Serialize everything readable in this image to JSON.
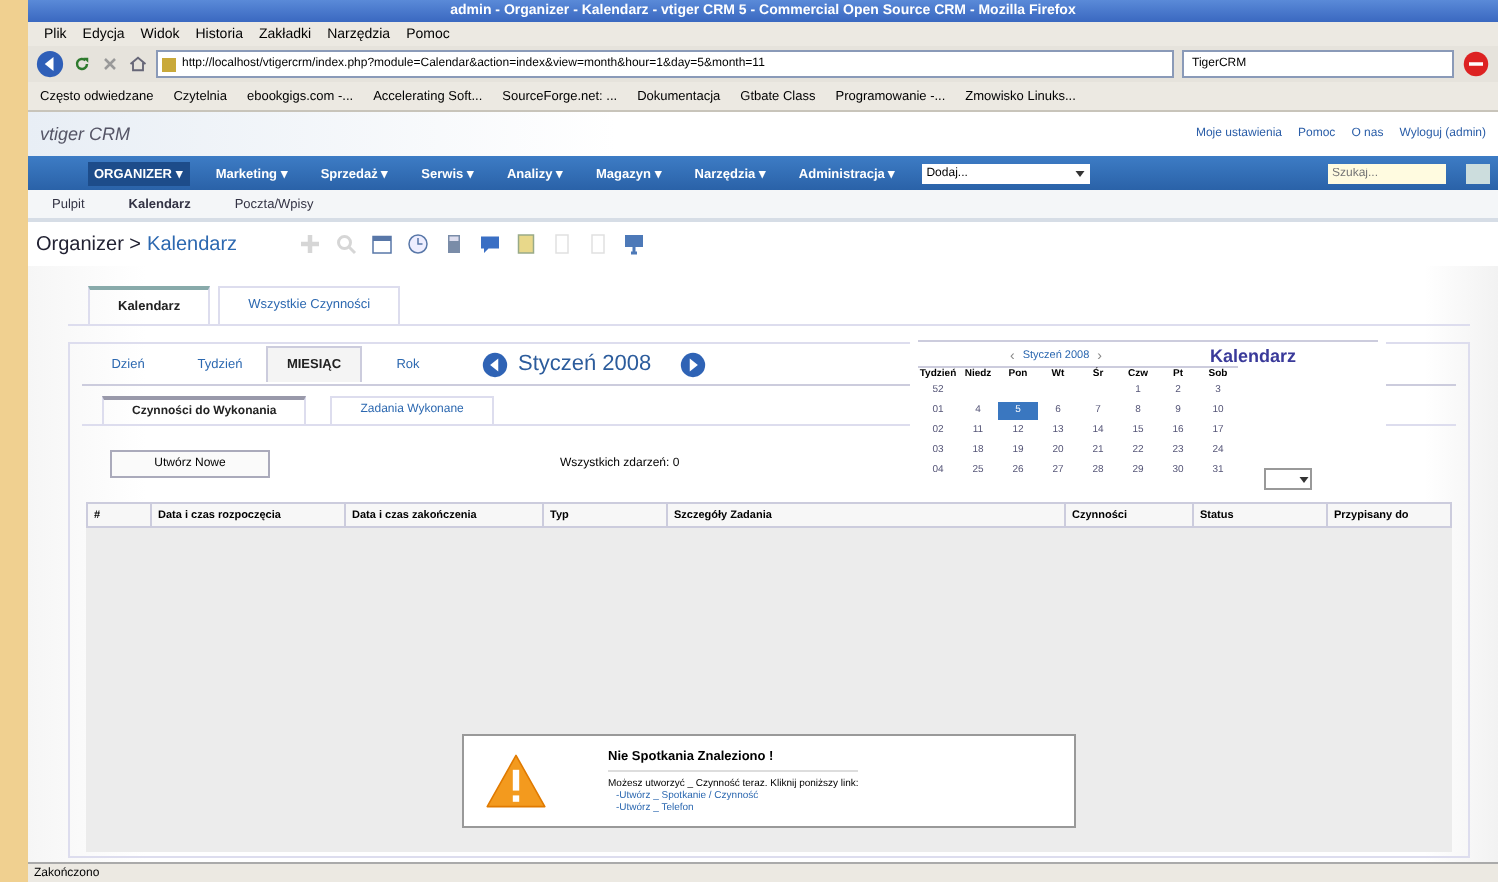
{
  "window": {
    "title": "admin - Organizer - Kalendarz - vtiger CRM 5 - Commercial Open Source CRM - Mozilla Firefox"
  },
  "menu_bar": [
    "Plik",
    "Edycja",
    "Widok",
    "Historia",
    "Zakładki",
    "Narzędzia",
    "Pomoc"
  ],
  "address_bar": {
    "url": "http://localhost/vtigercrm/index.php?module=Calendar&action=index&view=month&hour=1&day=5&month=11"
  },
  "search_engine": {
    "value": "TigerCRM"
  },
  "bookmarks": [
    "Często odwiedzane",
    "Czytelnia",
    "ebookgigs.com -...",
    "Accelerating Soft...",
    "SourceForge.net: ...",
    "Dokumentacja",
    "Gtbate Class",
    "Programowanie -...",
    "Zmowisko Linuks..."
  ],
  "app": {
    "logo": "vtiger CRM",
    "header_links": [
      "Moje ustawienia",
      "Pomoc",
      "O nas",
      "Wyloguj (admin)"
    ]
  },
  "main_menu": [
    {
      "label": "ORGANIZER ▾",
      "selected": true
    },
    {
      "label": "Marketing ▾",
      "selected": false
    },
    {
      "label": "Sprzedaż ▾",
      "selected": false
    },
    {
      "label": "Serwis ▾",
      "selected": false
    },
    {
      "label": "Analizy ▾",
      "selected": false
    },
    {
      "label": "Magazyn ▾",
      "selected": false
    },
    {
      "label": "Narzędzia ▾",
      "selected": false
    },
    {
      "label": "Administracja ▾",
      "selected": false
    }
  ],
  "quick_create": {
    "value": "Dodaj..."
  },
  "search": {
    "placeholder": "Szukaj..."
  },
  "sub_tabs": [
    {
      "label": "Pulpit",
      "selected": false
    },
    {
      "label": "Kalendarz",
      "selected": true
    },
    {
      "label": "Poczta/Wpisy",
      "selected": false
    }
  ],
  "breadcrumb": {
    "module": "Organizer >",
    "page": "Kalendarz"
  },
  "outer_tabs": [
    {
      "label": "Kalendarz",
      "selected": true
    },
    {
      "label": "Wszystkie Czynności",
      "selected": false
    }
  ],
  "view_tabs": [
    {
      "label": "Dzień",
      "selected": false
    },
    {
      "label": "Tydzień",
      "selected": false
    },
    {
      "label": "MIESIĄC",
      "selected": true
    },
    {
      "label": "Rok",
      "selected": false
    }
  ],
  "period": "Styczeń 2008",
  "inner_tabs": [
    {
      "label": "Czynności do Wykonania",
      "selected": true
    },
    {
      "label": "Zadania Wykonane",
      "selected": false
    }
  ],
  "create_button": "Utwórz Nowe",
  "total": "Wszystkich zdarzeń: 0",
  "table": {
    "columns": [
      "#",
      "Data i czas rozpoczęcia",
      "Data i czas zakończenia",
      "Typ",
      "Szczegóły Zadania",
      "Czynności",
      "Status",
      "Przypisany do"
    ]
  },
  "message": {
    "title": "Nie Spotkania Znaleziono !",
    "text": "Możesz utworzyć _ Czynność teraz. Kliknij poniższy link:",
    "links": [
      "-Utwórz _ Spotkanie / Czynność",
      "-Utwórz _ Telefon"
    ]
  },
  "mini_calendar": {
    "title": "Styczeń 2008",
    "heading": "Kalendarz",
    "columns": [
      "Tydzień",
      "Niedz",
      "Pon",
      "Wt",
      "Śr",
      "Czw",
      "Pt",
      "Sob"
    ],
    "prev": "‹",
    "next": "›",
    "weeks": [
      {
        "week": "52",
        "days": [
          {
            "day": "1",
            "selected": false
          },
          {
            "day": "2",
            "selected": false
          },
          {
            "day": "3",
            "selected": false
          }
        ]
      },
      {
        "week": "01",
        "days": [
          {
            "day": "4",
            "selected": false
          },
          {
            "day": "5",
            "selected": true
          },
          {
            "day": "6",
            "selected": false
          },
          {
            "day": "7",
            "selected": false
          },
          {
            "day": "8",
            "selected": false
          },
          {
            "day": "9",
            "selected": false
          },
          {
            "day": "10",
            "selected": false
          }
        ]
      },
      {
        "week": "02",
        "days": [
          {
            "day": "11",
            "selected": false
          },
          {
            "day": "12",
            "selected": false
          },
          {
            "day": "13",
            "selected": false
          },
          {
            "day": "14",
            "selected": false
          },
          {
            "day": "15",
            "selected": false
          },
          {
            "day": "16",
            "selected": false
          },
          {
            "day": "17",
            "selected": false
          }
        ]
      },
      {
        "week": "03",
        "days": [
          {
            "day": "18",
            "selected": false
          },
          {
            "day": "19",
            "selected": false
          },
          {
            "day": "20",
            "selected": false
          },
          {
            "day": "21",
            "selected": false
          },
          {
            "day": "22",
            "selected": false
          },
          {
            "day": "23",
            "selected": false
          },
          {
            "day": "24",
            "selected": false
          }
        ]
      },
      {
        "week": "04",
        "days": [
          {
            "day": "25",
            "selected": false
          },
          {
            "day": "26",
            "selected": false
          },
          {
            "day": "27",
            "selected": false
          },
          {
            "day": "28",
            "selected": false
          },
          {
            "day": "29",
            "selected": false
          },
          {
            "day": "30",
            "selected": false
          },
          {
            "day": "31",
            "selected": false
          }
        ]
      }
    ]
  },
  "status_bar": "Zakończono"
}
